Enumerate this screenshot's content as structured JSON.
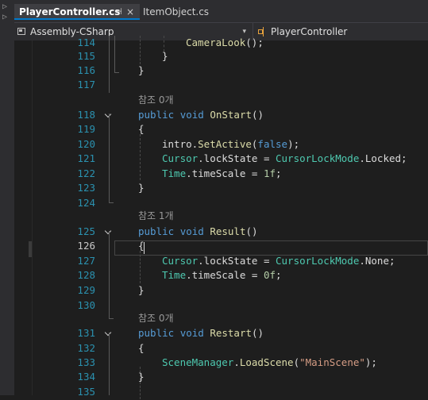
{
  "tabs": [
    {
      "label": "PlayerController.cs",
      "active": true
    },
    {
      "label": "ItemObject.cs",
      "active": false
    }
  ],
  "tab_pin_glyph": "⊣",
  "tab_close_glyph": "×",
  "navbar": {
    "project": "Assembly-CSharp",
    "project_icon": "csharp-project-icon",
    "type": "PlayerController",
    "type_icon": "class-icon",
    "dropdown_glyph": "▾"
  },
  "colors": {
    "background": "#1e1e1e",
    "keyword": "#569cd6",
    "type": "#4ec9b0",
    "method": "#dcdcaa",
    "string": "#d69d85",
    "number": "#b5cea8",
    "line_number": "#2b91af",
    "codelens": "#999999",
    "active_tab_accent": "#007acc"
  },
  "codelens": [
    "참조 0개",
    "참조 1개",
    "참조 0개"
  ],
  "current_line": "126",
  "lines": [
    {
      "n": "114",
      "tokens": [
        {
          "t": "CameraLook",
          "c": "fn"
        },
        {
          "t": "();",
          "c": "pl"
        }
      ]
    },
    {
      "n": "115",
      "tokens": [
        {
          "t": "}",
          "c": "pl"
        }
      ]
    },
    {
      "n": "116",
      "tokens": [
        {
          "t": "}",
          "c": "pl"
        }
      ]
    },
    {
      "n": "117",
      "tokens": []
    },
    {
      "n": "118",
      "tokens": [
        {
          "t": "public",
          "c": "kw"
        },
        {
          "t": " ",
          "c": "pl"
        },
        {
          "t": "void",
          "c": "kw"
        },
        {
          "t": " ",
          "c": "pl"
        },
        {
          "t": "OnStart",
          "c": "fn"
        },
        {
          "t": "()",
          "c": "pl"
        }
      ]
    },
    {
      "n": "119",
      "tokens": [
        {
          "t": "{",
          "c": "pl"
        }
      ]
    },
    {
      "n": "120",
      "tokens": [
        {
          "t": "intro.",
          "c": "pl"
        },
        {
          "t": "SetActive",
          "c": "fn"
        },
        {
          "t": "(",
          "c": "pl"
        },
        {
          "t": "false",
          "c": "kw"
        },
        {
          "t": ");",
          "c": "pl"
        }
      ]
    },
    {
      "n": "121",
      "tokens": [
        {
          "t": "Cursor",
          "c": "ty"
        },
        {
          "t": ".lockState = ",
          "c": "pl"
        },
        {
          "t": "CursorLockMode",
          "c": "ty"
        },
        {
          "t": ".Locked;",
          "c": "pl"
        }
      ]
    },
    {
      "n": "122",
      "tokens": [
        {
          "t": "Time",
          "c": "ty"
        },
        {
          "t": ".timeScale = ",
          "c": "pl"
        },
        {
          "t": "1f",
          "c": "nm"
        },
        {
          "t": ";",
          "c": "pl"
        }
      ]
    },
    {
      "n": "123",
      "tokens": [
        {
          "t": "}",
          "c": "pl"
        }
      ]
    },
    {
      "n": "124",
      "tokens": []
    },
    {
      "n": "125",
      "tokens": [
        {
          "t": "public",
          "c": "kw"
        },
        {
          "t": " ",
          "c": "pl"
        },
        {
          "t": "void",
          "c": "kw"
        },
        {
          "t": " ",
          "c": "pl"
        },
        {
          "t": "Result",
          "c": "fn"
        },
        {
          "t": "()",
          "c": "pl"
        }
      ]
    },
    {
      "n": "126",
      "tokens": [
        {
          "t": "{",
          "c": "pl"
        }
      ]
    },
    {
      "n": "127",
      "tokens": [
        {
          "t": "Cursor",
          "c": "ty"
        },
        {
          "t": ".lockState = ",
          "c": "pl"
        },
        {
          "t": "CursorLockMode",
          "c": "ty"
        },
        {
          "t": ".None;",
          "c": "pl"
        }
      ]
    },
    {
      "n": "128",
      "tokens": [
        {
          "t": "Time",
          "c": "ty"
        },
        {
          "t": ".timeScale = ",
          "c": "pl"
        },
        {
          "t": "0f",
          "c": "nm"
        },
        {
          "t": ";",
          "c": "pl"
        }
      ]
    },
    {
      "n": "129",
      "tokens": [
        {
          "t": "}",
          "c": "pl"
        }
      ]
    },
    {
      "n": "130",
      "tokens": []
    },
    {
      "n": "131",
      "tokens": [
        {
          "t": "public",
          "c": "kw"
        },
        {
          "t": " ",
          "c": "pl"
        },
        {
          "t": "void",
          "c": "kw"
        },
        {
          "t": " ",
          "c": "pl"
        },
        {
          "t": "Restart",
          "c": "fn"
        },
        {
          "t": "()",
          "c": "pl"
        }
      ]
    },
    {
      "n": "132",
      "tokens": [
        {
          "t": "{",
          "c": "pl"
        }
      ]
    },
    {
      "n": "133",
      "tokens": [
        {
          "t": "SceneManager",
          "c": "ty"
        },
        {
          "t": ".",
          "c": "pl"
        },
        {
          "t": "LoadScene",
          "c": "fn"
        },
        {
          "t": "(",
          "c": "pl"
        },
        {
          "t": "\"MainScene\"",
          "c": "st"
        },
        {
          "t": ");",
          "c": "pl"
        }
      ]
    },
    {
      "n": "134",
      "tokens": [
        {
          "t": "}",
          "c": "pl"
        }
      ]
    },
    {
      "n": "135",
      "tokens": []
    }
  ]
}
